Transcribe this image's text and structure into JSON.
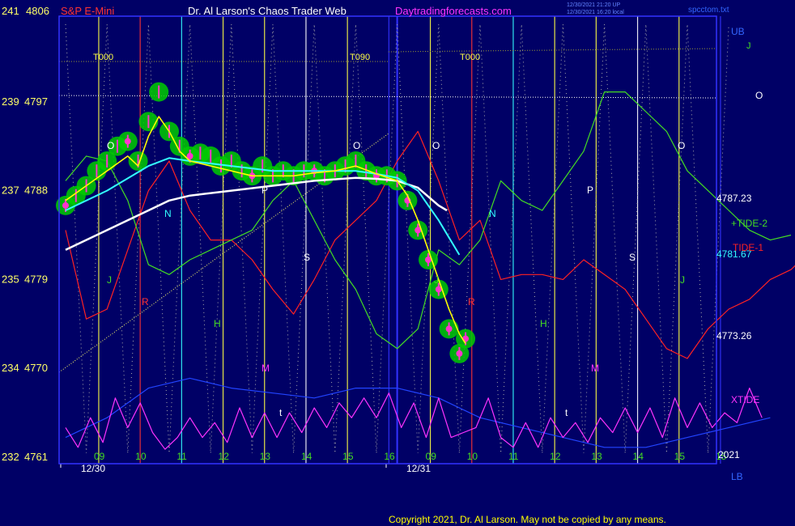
{
  "header": {
    "symbol": "S&P E-Mini",
    "title": "Dr. Al Larson's Chaos Trader Web",
    "site": "Daytradingforecasts.com",
    "stamp1": "12/30/2021 21:20 UP",
    "stamp2": "12/30/2021 16:20 local",
    "file": "spcctom.txt"
  },
  "footer": {
    "copyright": "Copyright 2021, Dr. Al Larson. May not be copied by any means."
  },
  "colors": {
    "background": "#000066",
    "frame": "#3333ff",
    "price_bar": "#ff33cc",
    "highlight": "#00cc00",
    "fast_avg": "#ffff00",
    "mid_avg": "#33ffff",
    "slow_avg": "#ffffff",
    "tide1": "#ff2222",
    "tide2": "#44dd22",
    "xtide": "#ff33ff",
    "blue_line": "#2244ff"
  },
  "chart_data": {
    "type": "line",
    "title": "S&P E-Mini",
    "y_axis": {
      "left_labels": [
        {
          "level": "241",
          "price": 4806
        },
        {
          "level": "239",
          "price": 4797
        },
        {
          "level": "237",
          "price": 4788
        },
        {
          "level": "235",
          "price": 4779
        },
        {
          "level": "234",
          "price": 4770
        },
        {
          "level": "232",
          "price": 4761
        }
      ],
      "ylim": [
        4761,
        4806
      ],
      "right_labels": [
        {
          "text": "4787.23",
          "price": 4787.23
        },
        {
          "text": "4781.67",
          "price": 4781.67
        },
        {
          "text": "4773.26",
          "price": 4773.26
        }
      ]
    },
    "x_axis": {
      "hour_labels": [
        "09",
        "10",
        "11",
        "12",
        "13",
        "14",
        "15",
        "16",
        "09",
        "10",
        "11",
        "12",
        "13",
        "14",
        "15",
        "15"
      ],
      "date_labels": [
        "12/30",
        "12/31"
      ],
      "year_label": "2021"
    },
    "edge_labels": {
      "upper": "UB",
      "lower": "LB",
      "right_j": "J",
      "right_o": "O"
    },
    "timing_labels": [
      "T000",
      "T090",
      "T000"
    ],
    "cycle_letters": {
      "day1": [
        "O",
        "J",
        "R",
        "N",
        "H",
        "M",
        "P",
        "S",
        "t",
        "O"
      ],
      "day2": [
        "O",
        "J",
        "R",
        "N",
        "H",
        "M",
        "P",
        "S",
        "t",
        "O",
        "J"
      ]
    },
    "legend": [
      {
        "name": "+TIDE-2",
        "color": "#44dd22"
      },
      {
        "name": "TIDE-1",
        "color": "#ff2222"
      },
      {
        "name": "XTIDE",
        "color": "#ff33ff"
      }
    ],
    "series": [
      {
        "name": "price",
        "points": [
          [
            0,
            4786.5
          ],
          [
            0.25,
            4787.5
          ],
          [
            0.5,
            4788.5
          ],
          [
            0.75,
            4790
          ],
          [
            1,
            4791
          ],
          [
            1.25,
            4792.5
          ],
          [
            1.5,
            4793
          ],
          [
            1.75,
            4791
          ],
          [
            2,
            4795
          ],
          [
            2.25,
            4798
          ],
          [
            2.5,
            4794
          ],
          [
            2.75,
            4792.5
          ],
          [
            3,
            4791.5
          ],
          [
            3.25,
            4791.8
          ],
          [
            3.5,
            4791.5
          ],
          [
            3.75,
            4790.5
          ],
          [
            4,
            4791
          ],
          [
            4.25,
            4790
          ],
          [
            4.5,
            4789.5
          ],
          [
            4.75,
            4790.5
          ],
          [
            5,
            4789.5
          ],
          [
            5.25,
            4790
          ],
          [
            5.5,
            4789.5
          ],
          [
            5.75,
            4790
          ],
          [
            6,
            4790
          ],
          [
            6.25,
            4789.5
          ],
          [
            6.5,
            4790
          ],
          [
            6.75,
            4790.5
          ],
          [
            7,
            4791
          ],
          [
            7.25,
            4790
          ],
          [
            7.5,
            4789.5
          ],
          [
            7.75,
            4789.5
          ],
          [
            8,
            4789
          ],
          [
            8.25,
            4787
          ],
          [
            8.5,
            4784
          ],
          [
            8.75,
            4781
          ],
          [
            9,
            4778
          ],
          [
            9.25,
            4774
          ],
          [
            9.5,
            4771.5
          ],
          [
            9.65,
            4773
          ]
        ]
      },
      {
        "name": "fast_avg",
        "points": [
          [
            0,
            4787
          ],
          [
            0.5,
            4788.5
          ],
          [
            1,
            4790
          ],
          [
            1.5,
            4791.5
          ],
          [
            1.75,
            4790.5
          ],
          [
            2,
            4793.5
          ],
          [
            2.25,
            4795.5
          ],
          [
            2.5,
            4794
          ],
          [
            2.75,
            4792
          ],
          [
            3,
            4791
          ],
          [
            3.5,
            4790.5
          ],
          [
            4,
            4790
          ],
          [
            4.5,
            4789.5
          ],
          [
            5,
            4789.5
          ],
          [
            5.5,
            4789.5
          ],
          [
            6,
            4789.8
          ],
          [
            6.5,
            4790
          ],
          [
            7,
            4790.5
          ],
          [
            7.5,
            4789.7
          ],
          [
            8,
            4789
          ],
          [
            8.25,
            4787.5
          ],
          [
            8.5,
            4785
          ],
          [
            8.75,
            4782
          ],
          [
            9,
            4779
          ],
          [
            9.25,
            4776
          ],
          [
            9.5,
            4773.5
          ],
          [
            9.65,
            4772.5
          ]
        ]
      },
      {
        "name": "mid_avg",
        "points": [
          [
            0,
            4786
          ],
          [
            1,
            4788
          ],
          [
            2,
            4790.5
          ],
          [
            2.5,
            4791.3
          ],
          [
            3,
            4791
          ],
          [
            4,
            4790.5
          ],
          [
            5,
            4790
          ],
          [
            6,
            4790
          ],
          [
            7,
            4790
          ],
          [
            7.5,
            4789.7
          ],
          [
            8,
            4789.3
          ],
          [
            8.5,
            4788
          ],
          [
            9,
            4785
          ],
          [
            9.5,
            4781.5
          ]
        ]
      },
      {
        "name": "slow_avg",
        "points": [
          [
            0,
            4782
          ],
          [
            1,
            4784
          ],
          [
            2,
            4786
          ],
          [
            2.5,
            4787
          ],
          [
            3,
            4787.5
          ],
          [
            4,
            4788
          ],
          [
            5,
            4788.5
          ],
          [
            6,
            4789
          ],
          [
            7,
            4789.3
          ],
          [
            7.5,
            4789.2
          ],
          [
            8,
            4789
          ],
          [
            8.5,
            4788.3
          ],
          [
            9,
            4786.5
          ],
          [
            9.2,
            4786
          ]
        ]
      },
      {
        "name": "TIDE-1",
        "points": [
          [
            0,
            4784
          ],
          [
            0.5,
            4775
          ],
          [
            1,
            4776
          ],
          [
            1.5,
            4782
          ],
          [
            2,
            4788
          ],
          [
            2.5,
            4791
          ],
          [
            3,
            4786
          ],
          [
            3.5,
            4783
          ],
          [
            4,
            4783
          ],
          [
            4.5,
            4781
          ],
          [
            5,
            4778
          ],
          [
            5.5,
            4775.5
          ],
          [
            6,
            4779
          ],
          [
            6.5,
            4783
          ],
          [
            7,
            4785
          ],
          [
            7.5,
            4787
          ],
          [
            8,
            4791
          ],
          [
            8.5,
            4794
          ],
          [
            9,
            4789
          ],
          [
            9.5,
            4783
          ],
          [
            10,
            4785
          ],
          [
            10.5,
            4779
          ],
          [
            11,
            4779.5
          ],
          [
            11.5,
            4779.5
          ],
          [
            12,
            4779
          ],
          [
            12.5,
            4781
          ],
          [
            13,
            4779.5
          ],
          [
            13.5,
            4778
          ],
          [
            14,
            4775
          ],
          [
            14.5,
            4772
          ],
          [
            15,
            4771
          ],
          [
            15.5,
            4774
          ],
          [
            16,
            4776
          ],
          [
            16.5,
            4777
          ],
          [
            17,
            4779
          ],
          [
            17.5,
            4780
          ],
          [
            18,
            4782
          ],
          [
            18.5,
            4784
          ]
        ]
      },
      {
        "name": "+TIDE-2",
        "points": [
          [
            0,
            4789
          ],
          [
            0.5,
            4791.5
          ],
          [
            1,
            4791
          ],
          [
            1.5,
            4787
          ],
          [
            2,
            4780.5
          ],
          [
            2.5,
            4779.5
          ],
          [
            3,
            4781
          ],
          [
            3.5,
            4782
          ],
          [
            4,
            4783
          ],
          [
            4.5,
            4784
          ],
          [
            5,
            4787
          ],
          [
            5.5,
            4789
          ],
          [
            6,
            4785
          ],
          [
            6.5,
            4781
          ],
          [
            7,
            4778
          ],
          [
            7.5,
            4773.5
          ],
          [
            8,
            4772
          ],
          [
            8.5,
            4774
          ],
          [
            9,
            4782
          ],
          [
            9.5,
            4780.5
          ],
          [
            10,
            4783
          ],
          [
            10.5,
            4789
          ],
          [
            11,
            4787
          ],
          [
            11.5,
            4786
          ],
          [
            12,
            4789
          ],
          [
            12.5,
            4792
          ],
          [
            13,
            4798
          ],
          [
            13.5,
            4798
          ],
          [
            14,
            4796
          ],
          [
            14.5,
            4794
          ],
          [
            15,
            4790
          ],
          [
            15.5,
            4788
          ],
          [
            16,
            4786
          ],
          [
            16.5,
            4784
          ],
          [
            17,
            4783
          ],
          [
            17.5,
            4783.5
          ]
        ]
      },
      {
        "name": "XTIDE",
        "points": [
          [
            0,
            4764
          ],
          [
            0.3,
            4762
          ],
          [
            0.6,
            4765
          ],
          [
            0.9,
            4762.5
          ],
          [
            1.2,
            4767
          ],
          [
            1.5,
            4764
          ],
          [
            1.8,
            4766.5
          ],
          [
            2.1,
            4763.5
          ],
          [
            2.4,
            4761.8
          ],
          [
            2.7,
            4763
          ],
          [
            3,
            4765
          ],
          [
            3.3,
            4763
          ],
          [
            3.6,
            4764.5
          ],
          [
            3.9,
            4762.5
          ],
          [
            4.2,
            4766
          ],
          [
            4.5,
            4763
          ],
          [
            4.8,
            4765.5
          ],
          [
            5.1,
            4763
          ],
          [
            5.4,
            4765.5
          ],
          [
            5.7,
            4763.5
          ],
          [
            6,
            4766
          ],
          [
            6.3,
            4764
          ],
          [
            6.6,
            4766.5
          ],
          [
            6.9,
            4765
          ],
          [
            7.2,
            4767
          ],
          [
            7.5,
            4765
          ],
          [
            7.8,
            4767.5
          ],
          [
            8.1,
            4764
          ],
          [
            8.4,
            4766.5
          ],
          [
            8.7,
            4763
          ],
          [
            9,
            4767
          ],
          [
            9.3,
            4763
          ],
          [
            9.6,
            4763.5
          ],
          [
            9.9,
            4764
          ],
          [
            10.2,
            4767
          ],
          [
            10.5,
            4763
          ],
          [
            10.8,
            4762
          ],
          [
            11.1,
            4764.5
          ],
          [
            11.4,
            4762
          ],
          [
            11.7,
            4765
          ],
          [
            12,
            4763
          ],
          [
            12.3,
            4764.5
          ],
          [
            12.6,
            4762.5
          ],
          [
            12.9,
            4765
          ],
          [
            13.2,
            4763.5
          ],
          [
            13.5,
            4766
          ],
          [
            13.8,
            4763.5
          ],
          [
            14.1,
            4766
          ],
          [
            14.4,
            4763
          ],
          [
            14.7,
            4767
          ],
          [
            15,
            4764
          ],
          [
            15.3,
            4766.5
          ],
          [
            15.6,
            4764
          ],
          [
            15.9,
            4765.5
          ],
          [
            16.2,
            4764.5
          ],
          [
            16.5,
            4768
          ],
          [
            16.8,
            4765
          ]
        ]
      },
      {
        "name": "blue_line",
        "points": [
          [
            0,
            4763
          ],
          [
            1,
            4765
          ],
          [
            2,
            4768
          ],
          [
            3,
            4769
          ],
          [
            4,
            4768
          ],
          [
            5,
            4767.5
          ],
          [
            6,
            4767
          ],
          [
            7,
            4768
          ],
          [
            8,
            4768
          ],
          [
            9,
            4767
          ],
          [
            10,
            4765
          ],
          [
            11,
            4764
          ],
          [
            12,
            4763
          ],
          [
            13,
            4762
          ],
          [
            14,
            4762
          ],
          [
            15,
            4763
          ],
          [
            16,
            4764
          ],
          [
            17,
            4765
          ]
        ]
      }
    ]
  }
}
